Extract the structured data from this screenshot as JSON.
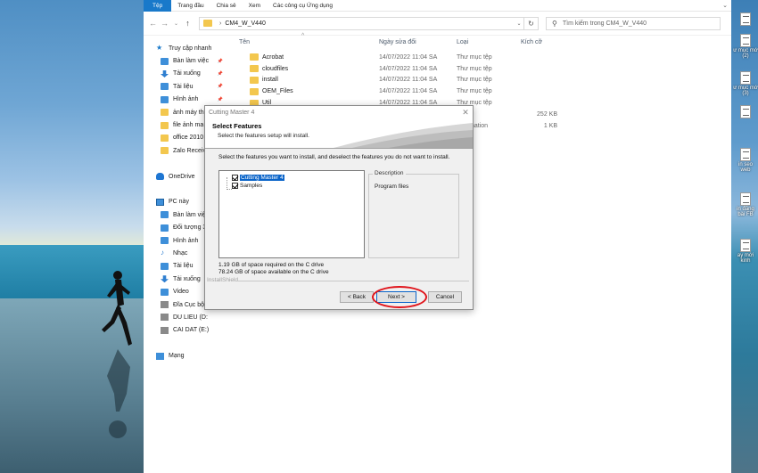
{
  "ribbon": {
    "tabs": [
      "Tệp",
      "Trang đầu",
      "Chia sẻ",
      "Xem",
      "Các công cụ Ứng dụng"
    ]
  },
  "address": {
    "path": "CM4_W_V440",
    "search_placeholder": "Tìm kiếm trong CM4_W_V440"
  },
  "nav": {
    "items": [
      {
        "label": "Truy cập nhanh",
        "icon": "star-icon"
      },
      {
        "label": "Bàn làm việc",
        "icon": "desktop-icon",
        "pinned": true
      },
      {
        "label": "Tải xuống",
        "icon": "download-icon",
        "pinned": true
      },
      {
        "label": "Tài liệu",
        "icon": "documents-icon",
        "pinned": true
      },
      {
        "label": "Hình ảnh",
        "icon": "pictures-icon",
        "pinned": true
      },
      {
        "label": "ảnh máy th",
        "icon": "folder-icon"
      },
      {
        "label": "file ảnh ma",
        "icon": "folder-icon"
      },
      {
        "label": "office 2010",
        "icon": "folder-icon"
      },
      {
        "label": "Zalo Receiv",
        "icon": "folder-icon"
      },
      {
        "label": "",
        "icon": ""
      },
      {
        "label": "OneDrive",
        "icon": "cloud-icon"
      },
      {
        "label": "",
        "icon": ""
      },
      {
        "label": "PC này",
        "icon": "pc-icon"
      },
      {
        "label": "Bàn làm việ",
        "icon": "desktop-icon"
      },
      {
        "label": "Đối tượng 3",
        "icon": "objects-3d-icon"
      },
      {
        "label": "Hình ảnh",
        "icon": "pictures-icon"
      },
      {
        "label": "Nhạc",
        "icon": "music-icon"
      },
      {
        "label": "Tài liệu",
        "icon": "documents-icon"
      },
      {
        "label": "Tải xuống",
        "icon": "download-icon"
      },
      {
        "label": "Video",
        "icon": "video-icon"
      },
      {
        "label": "Đĩa Cục bộ",
        "icon": "drive-icon"
      },
      {
        "label": "DU LIEU (D:",
        "icon": "drive-icon"
      },
      {
        "label": "CAI DAT (E:)",
        "icon": "drive-icon"
      },
      {
        "label": "",
        "icon": ""
      },
      {
        "label": "Mạng",
        "icon": "network-icon"
      }
    ]
  },
  "columns": {
    "name": "Tên",
    "date": "Ngày sửa đổi",
    "type": "Loại",
    "size": "Kích cỡ"
  },
  "files": [
    {
      "name": "Acrobat",
      "date": "14/07/2022 11:04 SA",
      "type": "Thư mục tệp",
      "size": ""
    },
    {
      "name": "cloudfiles",
      "date": "14/07/2022 11:04 SA",
      "type": "Thư mục tệp",
      "size": ""
    },
    {
      "name": "install",
      "date": "14/07/2022 11:04 SA",
      "type": "Thư mục tệp",
      "size": ""
    },
    {
      "name": "OEM_Files",
      "date": "14/07/2022 11:04 SA",
      "type": "Thư mục tệp",
      "size": ""
    },
    {
      "name": "Util",
      "date": "14/07/2022 11:04 SA",
      "type": "Thư mục tệp",
      "size": ""
    },
    {
      "name": "",
      "date": "",
      "type": "dụng",
      "size": "252 KB"
    },
    {
      "name": "",
      "date": "",
      "type": "Information",
      "size": "1 KB"
    }
  ],
  "desktop_icons": [
    "",
    "ư mục mớ (2)",
    "ư mục mớ (3)",
    "",
    "in seo web",
    "in đăng bài FB",
    "ay mới kinh"
  ],
  "dialog": {
    "title": "Cutting Master 4",
    "heading": "Select Features",
    "subheading": "Select the features setup will install.",
    "instruction": "Select the features you want to install, and deselect the features you do not want to install.",
    "features": [
      {
        "label": "Cutting Master 4",
        "checked": true,
        "selected": true
      },
      {
        "label": "Samples",
        "checked": true,
        "selected": false
      }
    ],
    "description_label": "Description",
    "description_value": "Program files",
    "space_required": "1.19 GB of space required on the C drive",
    "space_available": "78.24 GB of space available on the C drive",
    "brand": "InstallShield",
    "back_label": "< Back",
    "next_label": "Next >",
    "cancel_label": "Cancel"
  },
  "colors": {
    "accent": "#1979ca",
    "folder": "#f3c74e",
    "highlight_ring": "#e0151c",
    "selection": "#0a64c9"
  }
}
